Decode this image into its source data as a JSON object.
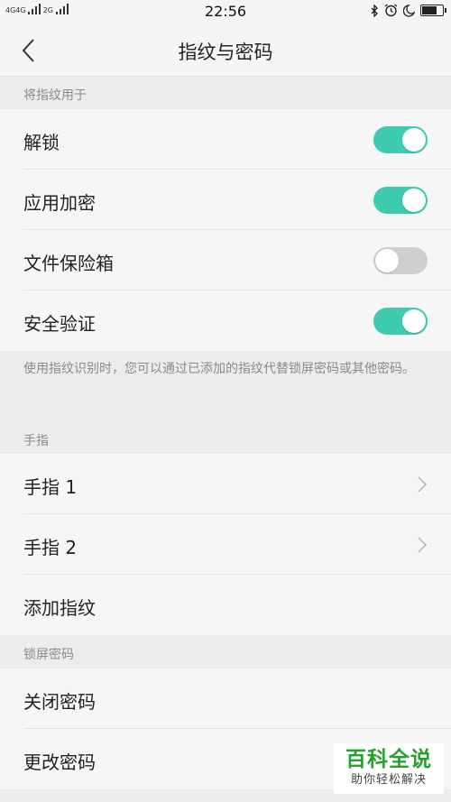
{
  "status_bar": {
    "network_1": "4G",
    "network_2": "4G",
    "network_3": "2G",
    "time": "22:56",
    "battery_level": 0.65
  },
  "header": {
    "title": "指纹与密码"
  },
  "sections": {
    "use_fingerprint": {
      "header": "将指纹用于",
      "items": [
        {
          "label": "解锁",
          "toggle": "on"
        },
        {
          "label": "应用加密",
          "toggle": "on"
        },
        {
          "label": "文件保险箱",
          "toggle": "off"
        },
        {
          "label": "安全验证",
          "toggle": "on"
        }
      ],
      "note": "使用指纹识别时，您可以通过已添加的指纹代替锁屏密码或其他密码。"
    },
    "fingers": {
      "header": "手指",
      "items": [
        {
          "label": "手指 1"
        },
        {
          "label": "手指 2"
        },
        {
          "label": "添加指纹"
        }
      ]
    },
    "lock_password": {
      "header": "锁屏密码",
      "items": [
        {
          "label": "关闭密码"
        },
        {
          "label": "更改密码"
        }
      ]
    }
  },
  "watermark": {
    "title": "百科全说",
    "subtitle": "助你轻松解决"
  },
  "colors": {
    "toggle_on": "#3fcbb0",
    "toggle_off": "#cfcfcf",
    "watermark_green": "#25a22c"
  }
}
